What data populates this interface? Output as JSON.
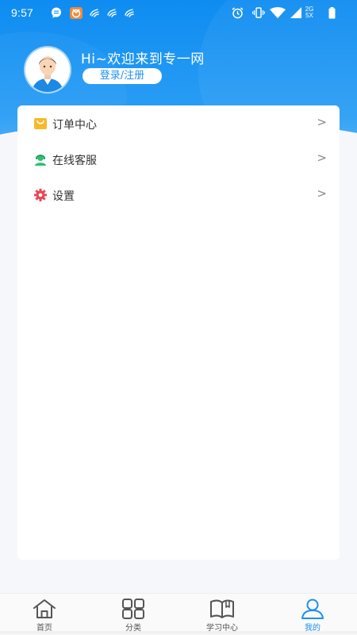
{
  "status_bar": {
    "time": "9:57",
    "network_label_top": "2G",
    "network_label_bottom": "5X"
  },
  "profile": {
    "greeting": "Hi~欢迎来到专一网",
    "login_label": "登录/注册",
    "avatar_icon": "user-avatar-icon"
  },
  "menu": {
    "items": [
      {
        "label": "订单中心",
        "icon": "order-bag-icon",
        "icon_color": "#f6b92b",
        "arrow": ">"
      },
      {
        "label": "在线客服",
        "icon": "customer-service-icon",
        "icon_color": "#2fbf71",
        "arrow": ">"
      },
      {
        "label": "设置",
        "icon": "gear-icon",
        "icon_color": "#e94857",
        "arrow": ">"
      }
    ]
  },
  "bottom_nav": {
    "items": [
      {
        "label": "首页",
        "icon": "home-icon",
        "active": false
      },
      {
        "label": "分类",
        "icon": "grid-icon",
        "active": false
      },
      {
        "label": "学习中心",
        "icon": "book-icon",
        "active": false
      },
      {
        "label": "我的",
        "icon": "person-icon",
        "active": true
      }
    ]
  },
  "colors": {
    "brand_blue": "#1e8ff0",
    "header_gradient_top": "#0e8cf1",
    "page_background": "#f6f7fb",
    "text_primary": "#333333"
  }
}
